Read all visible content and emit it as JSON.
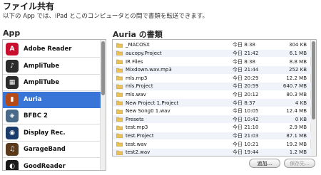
{
  "header": {
    "title": "ファイル共有",
    "subtitle": "以下の App では、iPad とこのコンピュータとの間で書類を転送できます。"
  },
  "apps_panel": {
    "heading": "App",
    "items": [
      {
        "label": "Adobe Reader",
        "icon": "adobe-reader-icon",
        "color": "#c8102e",
        "glyph": "A"
      },
      {
        "label": "AmpliTube",
        "icon": "amplitube-icon",
        "color": "#2b2b2b",
        "glyph": "♪"
      },
      {
        "label": "AmpliTube",
        "icon": "amplitube-icon",
        "color": "#2b2b2b",
        "glyph": "▦"
      },
      {
        "label": "Auria",
        "icon": "auria-icon",
        "color": "#b44a1a",
        "glyph": "▮"
      },
      {
        "label": "BFBC 2",
        "icon": "bfbc2-icon",
        "color": "#4a6a8a",
        "glyph": "◈"
      },
      {
        "label": "Display Rec.",
        "icon": "display-rec-icon",
        "color": "#1a3a6a",
        "glyph": "◉"
      },
      {
        "label": "GarageBand",
        "icon": "garageband-icon",
        "color": "#5a3a1a",
        "glyph": "♫"
      },
      {
        "label": "GoodReader",
        "icon": "goodreader-icon",
        "color": "#1a1a1a",
        "glyph": "◐"
      }
    ],
    "selected_index": 3
  },
  "docs_panel": {
    "heading": "Auria の書類",
    "files": [
      {
        "name": "_MACOSX",
        "date": "今日 8:38",
        "size": "304 KB"
      },
      {
        "name": "aucopy.Project",
        "date": "今日 21:42",
        "size": "6.1 MB"
      },
      {
        "name": "IR Files",
        "date": "今日 8:38",
        "size": "8.8 MB"
      },
      {
        "name": "Mixdown.wav.mp3",
        "date": "今日 21:44",
        "size": "252 KB"
      },
      {
        "name": "mls.mp3",
        "date": "今日 20:29",
        "size": "12.2 MB"
      },
      {
        "name": "mls.Project",
        "date": "今日 20:59",
        "size": "640.7 MB"
      },
      {
        "name": "mls.wav",
        "date": "今日 20:12",
        "size": "80.3 MB"
      },
      {
        "name": "New Project 1.Project",
        "date": "今日 8:37",
        "size": "4 KB"
      },
      {
        "name": "New Song0 1.wav",
        "date": "今日 10:05",
        "size": "12.4 MB"
      },
      {
        "name": "Presets",
        "date": "今日 10:42",
        "size": "0 KB"
      },
      {
        "name": "test.mp3",
        "date": "今日 21:10",
        "size": "2.9 MB"
      },
      {
        "name": "test.Project",
        "date": "今日 21:03",
        "size": "87.1 MB"
      },
      {
        "name": "test.wav",
        "date": "今日 10:21",
        "size": "19.2 MB"
      },
      {
        "name": "test2.wav",
        "date": "今日 19:44",
        "size": "1.2 MB"
      }
    ]
  },
  "buttons": {
    "add_label": "追加...",
    "save_label": "保存先..."
  },
  "colors": {
    "selection": "#3875d7",
    "folder": "#e8c15a"
  }
}
